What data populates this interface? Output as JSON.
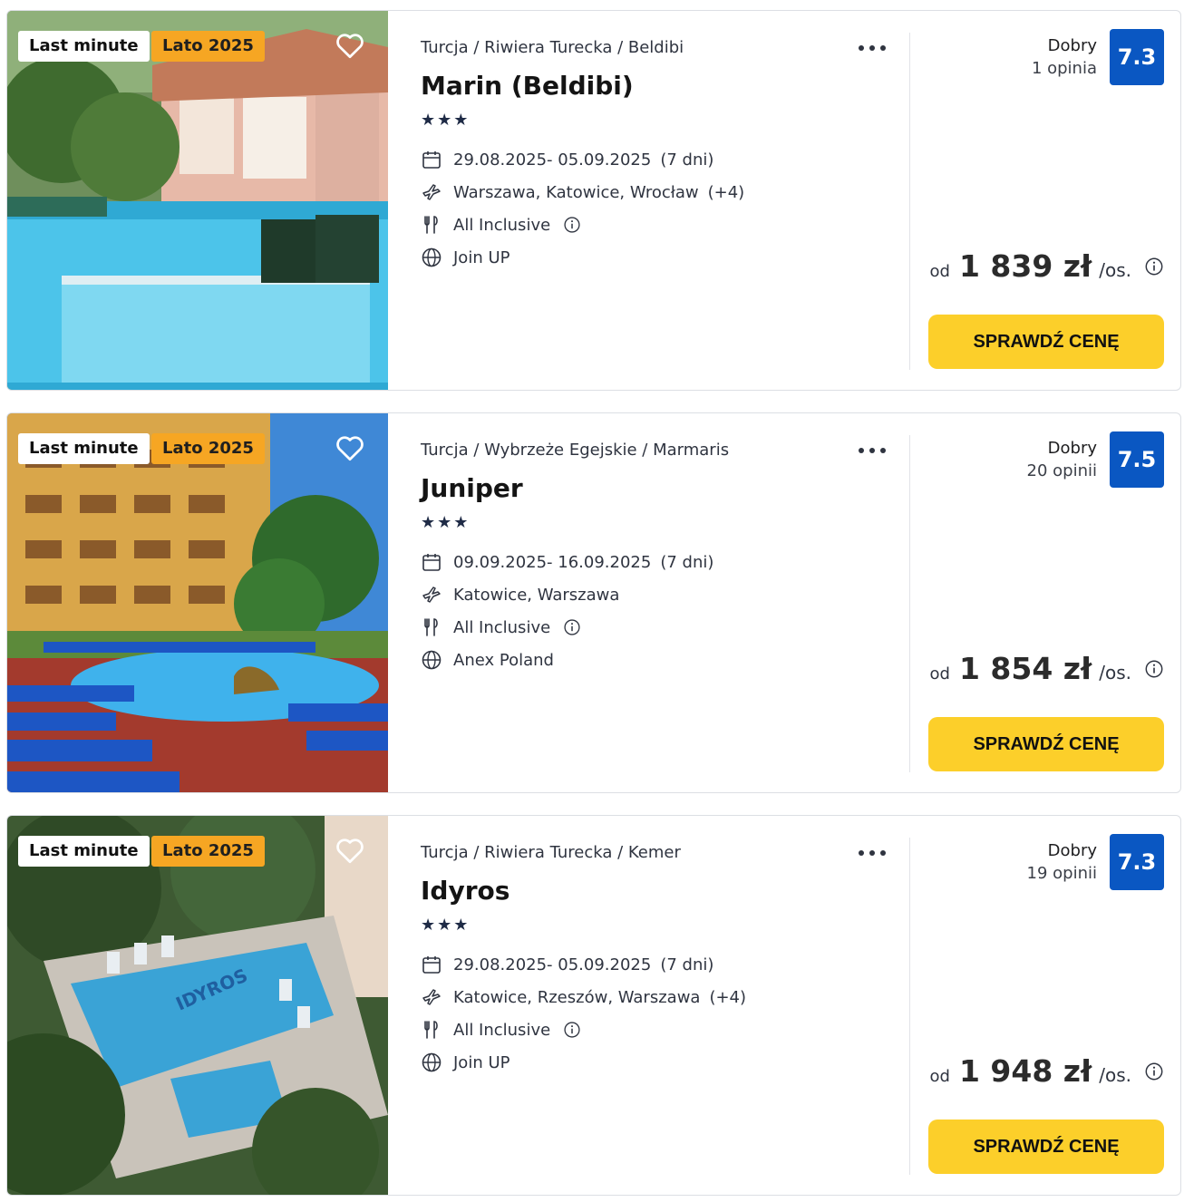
{
  "colors": {
    "score_bg": "#0a57c2",
    "cta_bg": "#fccf2a",
    "season_badge_bg": "#f6a623",
    "text_dark": "#1d1d1f"
  },
  "icons": {
    "calendar": "calendar-icon",
    "flight": "plane-icon",
    "board": "fork-knife-icon",
    "operator": "globe-icon",
    "favourite": "heart-icon",
    "more": "more-dots-icon",
    "info": "info-icon"
  },
  "offers": [
    {
      "badges": {
        "primary": "Last minute",
        "season": "Lato 2025"
      },
      "breadcrumb": "Turcja / Riwiera Turecka / Beldibi",
      "name": "Marin (Beldibi)",
      "stars": "★★★",
      "dates": "29.08.2025- 05.09.2025",
      "duration": "(7 dni)",
      "departures": "Warszawa, Katowice, Wrocław",
      "departures_more": "(+4)",
      "board": "All Inclusive",
      "operator": "Join UP",
      "rating": {
        "label": "Dobry",
        "count": "1 opinia",
        "score": "7.3"
      },
      "price": {
        "from": "od",
        "amount": "1 839 zł",
        "per": "/os."
      },
      "cta": "SPRAWDŹ CENĘ"
    },
    {
      "badges": {
        "primary": "Last minute",
        "season": "Lato 2025"
      },
      "breadcrumb": "Turcja / Wybrzeże Egejskie / Marmaris",
      "name": "Juniper",
      "stars": "★★★",
      "dates": "09.09.2025- 16.09.2025",
      "duration": "(7 dni)",
      "departures": "Katowice, Warszawa",
      "departures_more": "",
      "board": "All Inclusive",
      "operator": "Anex Poland",
      "rating": {
        "label": "Dobry",
        "count": "20 opinii",
        "score": "7.5"
      },
      "price": {
        "from": "od",
        "amount": "1 854 zł",
        "per": "/os."
      },
      "cta": "SPRAWDŹ CENĘ"
    },
    {
      "badges": {
        "primary": "Last minute",
        "season": "Lato 2025"
      },
      "breadcrumb": "Turcja / Riwiera Turecka / Kemer",
      "name": "Idyros",
      "stars": "★★★",
      "dates": "29.08.2025- 05.09.2025",
      "duration": "(7 dni)",
      "departures": "Katowice, Rzeszów, Warszawa",
      "departures_more": "(+4)",
      "board": "All Inclusive",
      "operator": "Join UP",
      "rating": {
        "label": "Dobry",
        "count": "19 opinii",
        "score": "7.3"
      },
      "price": {
        "from": "od",
        "amount": "1 948 zł",
        "per": "/os."
      },
      "cta": "SPRAWDŹ CENĘ"
    }
  ]
}
